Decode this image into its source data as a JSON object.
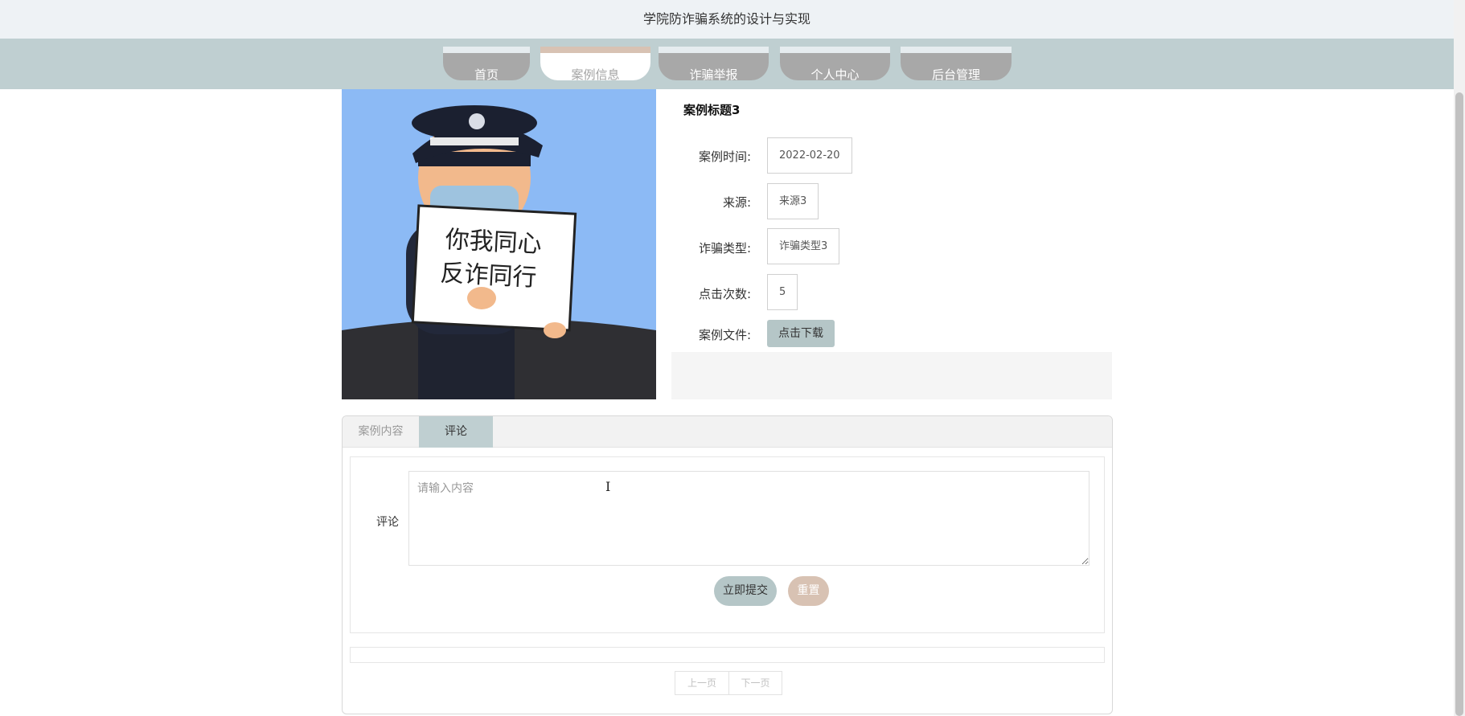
{
  "header": {
    "title": "学院防诈骗系统的设计与实现"
  },
  "nav": {
    "items": [
      {
        "label": "首页"
      },
      {
        "label": "案例信息"
      },
      {
        "label": "诈骗举报"
      },
      {
        "label": "个人中心"
      },
      {
        "label": "后台管理"
      }
    ],
    "active_index": 1
  },
  "case": {
    "cover_sign_line1": "你我同心",
    "cover_sign_line2": "反诈同行",
    "title": "案例标题3",
    "fields": [
      {
        "label": "案例时间:",
        "value": "2022-02-20"
      },
      {
        "label": "来源:",
        "value": "来源3"
      },
      {
        "label": "诈骗类型:",
        "value": "诈骗类型3"
      },
      {
        "label": "点击次数:",
        "value": "5"
      }
    ],
    "file_label": "案例文件:",
    "download_label": "点击下载"
  },
  "tabs": [
    {
      "label": "案例内容"
    },
    {
      "label": "评论"
    }
  ],
  "active_tab": 1,
  "comment": {
    "label": "评论",
    "placeholder": "请输入内容",
    "submit_label": "立即提交",
    "reset_label": "重置"
  },
  "pager": {
    "prev_label": "上一页",
    "next_label": "下一页"
  },
  "colors": {
    "nav_bg": "#bfcfd1",
    "accent": "#b5c6c7",
    "reset": "#d8c2b3",
    "tab_active": "#bfcfd1"
  }
}
